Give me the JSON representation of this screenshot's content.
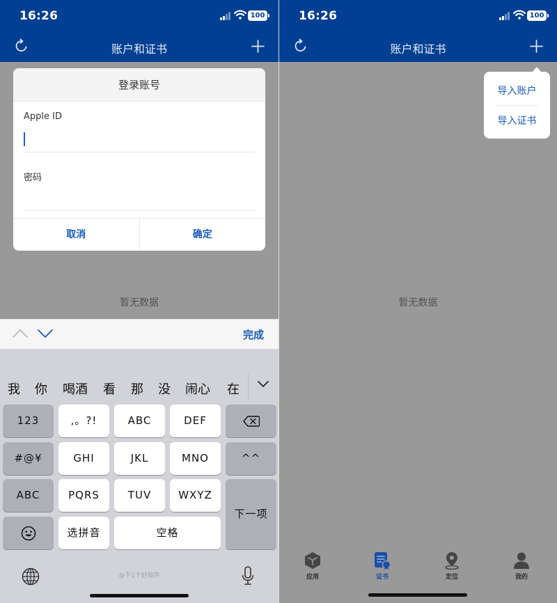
{
  "status": {
    "time": "16:26",
    "battery": "100"
  },
  "nav": {
    "title": "账户和证书"
  },
  "dialog": {
    "title": "登录账号",
    "apple_id_label": "Apple ID",
    "apple_id_value": "",
    "password_label": "密码",
    "password_value": "",
    "cancel": "取消",
    "confirm": "确定"
  },
  "empty_text": "暂无数据",
  "accessory": {
    "done": "完成"
  },
  "keyboard": {
    "candidates": [
      "我",
      "你",
      "喝酒",
      "看",
      "那",
      "没",
      "闹心",
      "在"
    ],
    "keys": {
      "num": "123",
      "punct": ",。?!",
      "abc1": "ABC",
      "def": "DEF",
      "sym": "#@¥",
      "ghi": "GHI",
      "jkl": "JKL",
      "mno": "MNO",
      "face": "^^",
      "abc2": "ABC",
      "pqrs": "PQRS",
      "tuv": "TUV",
      "wxyz": "WXYZ",
      "next": "下一项",
      "pinyin": "选拼音",
      "space": "空格"
    },
    "watermark": "@下1个好软件"
  },
  "popover": {
    "items": [
      "导入账户",
      "导入证书"
    ]
  },
  "tabbar": {
    "items": [
      {
        "label": "应用",
        "icon": "cube-icon"
      },
      {
        "label": "证书",
        "icon": "certificate-icon",
        "active": true
      },
      {
        "label": "定位",
        "icon": "location-pin-icon"
      },
      {
        "label": "我的",
        "icon": "person-icon"
      }
    ]
  },
  "colors": {
    "header": "#003f91",
    "accent": "#1a5bb5",
    "overlay": "#999999",
    "keyboard": "#d2d3d8"
  }
}
